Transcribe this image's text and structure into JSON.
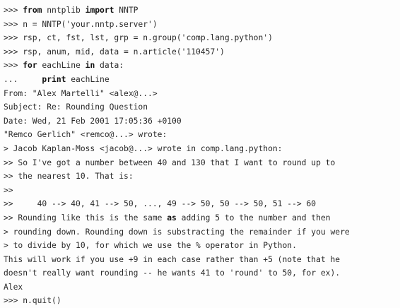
{
  "document": {
    "lines": [
      [
        {
          "t": ">>> "
        },
        {
          "t": "from",
          "kw": true
        },
        {
          "t": " nntplib "
        },
        {
          "t": "import",
          "kw": true
        },
        {
          "t": " NNTP"
        }
      ],
      [
        {
          "t": ">>> n = NNTP('your.nntp.server')"
        }
      ],
      [
        {
          "t": ">>> rsp, ct, fst, lst, grp = n.group('comp.lang.python')"
        }
      ],
      [
        {
          "t": ">>> rsp, anum, mid, data = n.article('110457')"
        }
      ],
      [
        {
          "t": ">>> "
        },
        {
          "t": "for",
          "kw": true
        },
        {
          "t": " eachLine "
        },
        {
          "t": "in",
          "kw": true
        },
        {
          "t": " data:"
        }
      ],
      [
        {
          "t": "...     "
        },
        {
          "t": "print",
          "kw": true
        },
        {
          "t": " eachLine"
        }
      ],
      [
        {
          "t": "From: \"Alex Martelli\" <alex@...>"
        }
      ],
      [
        {
          "t": "Subject: Re: Rounding Question"
        }
      ],
      [
        {
          "t": "Date: Wed, 21 Feb 2001 17:05:36 +0100"
        }
      ],
      [
        {
          "t": "\"Remco Gerlich\" <remco@...> wrote:"
        }
      ],
      [
        {
          "t": "> Jacob Kaplan-Moss <jacob@...> wrote in comp.lang.python:"
        }
      ],
      [
        {
          "t": ">> So I've got a number between 40 and 130 that I want to round up to"
        }
      ],
      [
        {
          "t": ">> the nearest 10. That is:"
        }
      ],
      [
        {
          "t": ">>"
        }
      ],
      [
        {
          "t": ">>     40 --> 40, 41 --> 50, ..., 49 --> 50, 50 --> 50, 51 --> 60"
        }
      ],
      [
        {
          "t": ">> Rounding like this is the same "
        },
        {
          "t": "as",
          "kw": true
        },
        {
          "t": " adding 5 to the number and then"
        }
      ],
      [
        {
          "t": "> rounding down. Rounding down is substracting the remainder if you were"
        }
      ],
      [
        {
          "t": "> to divide by 10, for which we use the % operator in Python."
        }
      ],
      [
        {
          "t": "This will work if you use +9 in each case rather than +5 (note that he"
        }
      ],
      [
        {
          "t": "doesn't really want rounding -- he wants 41 to 'round' to 50, for ex)."
        }
      ],
      [
        {
          "t": "Alex"
        }
      ],
      [
        {
          "t": ">>> n.quit()"
        }
      ]
    ]
  }
}
